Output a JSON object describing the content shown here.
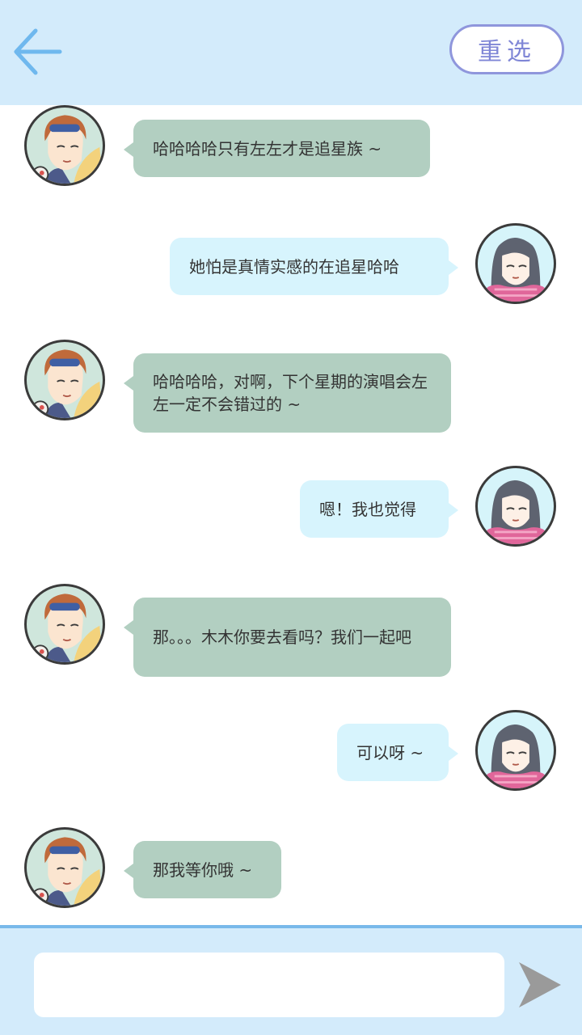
{
  "header": {
    "back_icon": "arrow-left-icon",
    "reselect_label": "重选",
    "colors": {
      "background": "#d3ebfb",
      "accent": "#6fb8ee",
      "reselect": "#8f96dc"
    }
  },
  "messages": [
    {
      "sender": "boy",
      "text": "哈哈哈哈只有左左才是追星族 ~"
    },
    {
      "sender": "girl",
      "text": "她怕是真情实感的在追星哈哈"
    },
    {
      "sender": "boy",
      "text": "哈哈哈哈，对啊，下个星期的演唱会左左一定不会错过的 ~"
    },
    {
      "sender": "girl",
      "text": "嗯！我也觉得"
    },
    {
      "sender": "boy",
      "text": "那。。。木木你要去看吗？我们一起吧"
    },
    {
      "sender": "girl",
      "text": "可以呀 ~"
    },
    {
      "sender": "boy",
      "text": "那我等你哦 ~"
    }
  ],
  "composer": {
    "input_value": "",
    "send_icon": "send-arrow-icon"
  },
  "colors": {
    "boy_bubble": "#b2cfc1",
    "girl_bubble": "#d7f4fd",
    "footer_border": "#79b9ea"
  }
}
